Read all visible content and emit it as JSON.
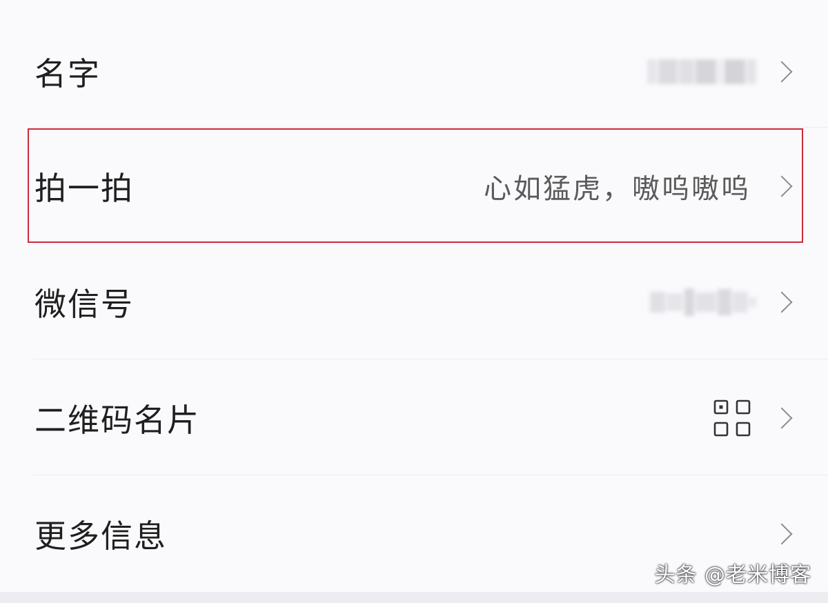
{
  "rows": [
    {
      "label": "名字",
      "value": ""
    },
    {
      "label": "拍一拍",
      "value": "心如猛虎，嗷呜嗷呜"
    },
    {
      "label": "微信号",
      "value": ""
    },
    {
      "label": "二维码名片",
      "icon": "qr-code-icon"
    },
    {
      "label": "更多信息",
      "value": ""
    }
  ],
  "watermark": "头条 @老米博客",
  "colors": {
    "background": "#fafafd",
    "highlight": "#cc2a3a",
    "label": "#1f1f1f",
    "value": "#5a5a5a",
    "chevron": "#8a8a8a"
  }
}
